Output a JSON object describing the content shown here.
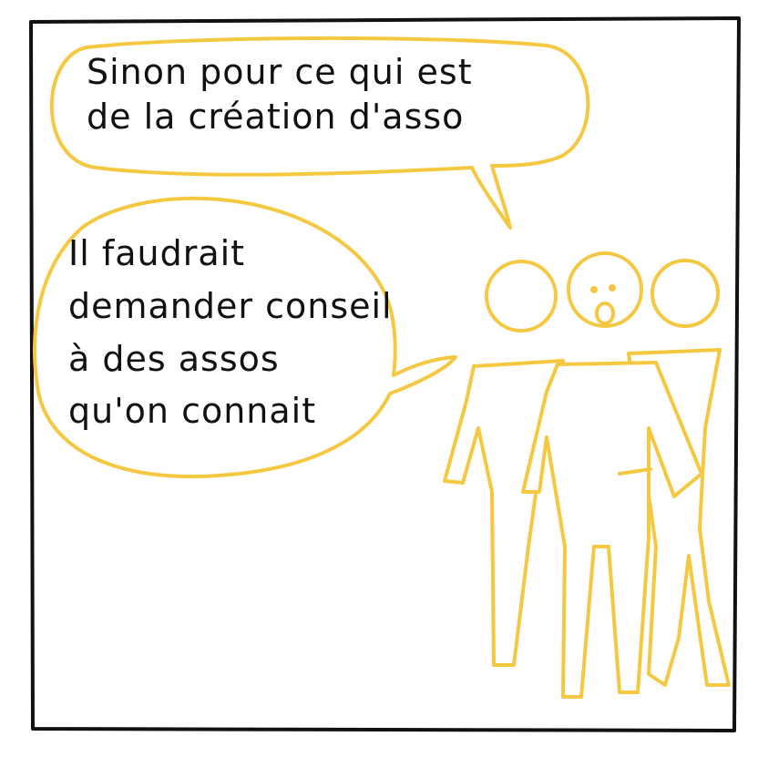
{
  "colors": {
    "frame": "#111111",
    "figures": "#f5c842",
    "bubbles": "#f5c842",
    "text": "#111111",
    "background": "#ffffff"
  },
  "bubble1": {
    "lines": [
      "Sinon pour ce qui est",
      "de la création d'asso"
    ]
  },
  "bubble2": {
    "lines": [
      "Il faudrait",
      "demander conseil",
      "à des assos",
      "qu'on connait"
    ]
  }
}
